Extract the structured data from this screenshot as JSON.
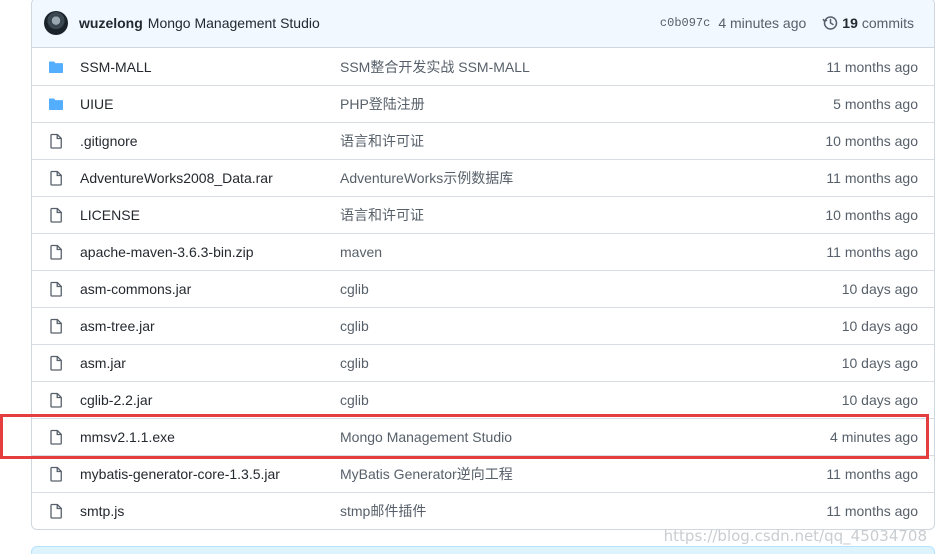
{
  "commit": {
    "author": "wuzelong",
    "message": "Mongo Management Studio",
    "sha": "c0b097c",
    "ago": "4 minutes ago",
    "commits_count": "19",
    "commits_label": "commits"
  },
  "files": [
    {
      "type": "dir",
      "name": "SSM-MALL",
      "message": "SSM整合开发实战 SSM-MALL",
      "age": "11 months ago"
    },
    {
      "type": "dir",
      "name": "UIUE",
      "message": "PHP登陆注册",
      "age": "5 months ago"
    },
    {
      "type": "file",
      "name": ".gitignore",
      "message": "语言和许可证",
      "age": "10 months ago"
    },
    {
      "type": "file",
      "name": "AdventureWorks2008_Data.rar",
      "message": "AdventureWorks示例数据库",
      "age": "11 months ago"
    },
    {
      "type": "file",
      "name": "LICENSE",
      "message": "语言和许可证",
      "age": "10 months ago"
    },
    {
      "type": "file",
      "name": "apache-maven-3.6.3-bin.zip",
      "message": "maven",
      "age": "11 months ago"
    },
    {
      "type": "file",
      "name": "asm-commons.jar",
      "message": "cglib",
      "age": "10 days ago"
    },
    {
      "type": "file",
      "name": "asm-tree.jar",
      "message": "cglib",
      "age": "10 days ago"
    },
    {
      "type": "file",
      "name": "asm.jar",
      "message": "cglib",
      "age": "10 days ago"
    },
    {
      "type": "file",
      "name": "cglib-2.2.jar",
      "message": "cglib",
      "age": "10 days ago"
    },
    {
      "type": "file",
      "name": "mmsv2.1.1.exe",
      "message": "Mongo Management Studio",
      "age": "4 minutes ago"
    },
    {
      "type": "file",
      "name": "mybatis-generator-core-1.3.5.jar",
      "message": "MyBatis Generator逆向工程",
      "age": "11 months ago"
    },
    {
      "type": "file",
      "name": "smtp.js",
      "message": "stmp邮件插件",
      "age": "11 months ago"
    }
  ],
  "watermark": "https://blog.csdn.net/qq_45034708",
  "colors": {
    "folder": "#54aeff",
    "file": "#57606a",
    "highlight": "#e53e3e"
  }
}
